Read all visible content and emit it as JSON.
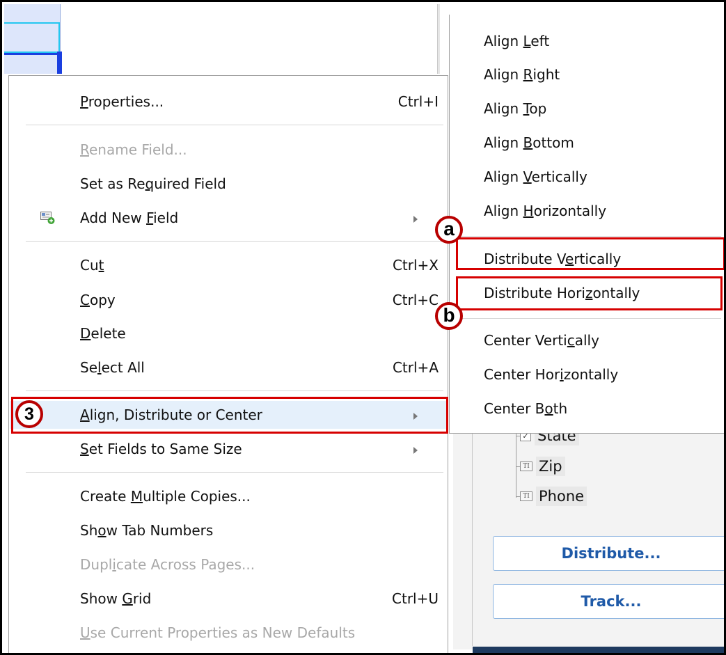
{
  "context_menu": {
    "items": [
      {
        "pre": "",
        "u": "P",
        "post": "roperties...",
        "shortcut": "Ctrl+I",
        "enabled": true
      },
      {
        "pre": "",
        "u": "R",
        "post": "ename Field...",
        "shortcut": "",
        "enabled": false
      },
      {
        "pre": "Set as Re",
        "u": "q",
        "post": "uired Field",
        "shortcut": "",
        "enabled": true
      },
      {
        "pre": "Add New ",
        "u": "F",
        "post": "ield",
        "shortcut": "",
        "enabled": true,
        "submenu": true,
        "icon": "add-field-icon"
      },
      {
        "pre": "Cu",
        "u": "t",
        "post": "",
        "shortcut": "Ctrl+X",
        "enabled": true
      },
      {
        "pre": "",
        "u": "C",
        "post": "opy",
        "shortcut": "Ctrl+C",
        "enabled": true
      },
      {
        "pre": "",
        "u": "D",
        "post": "elete",
        "shortcut": "",
        "enabled": true
      },
      {
        "pre": "Se",
        "u": "l",
        "post": "ect All",
        "shortcut": "Ctrl+A",
        "enabled": true
      },
      {
        "pre": "",
        "u": "A",
        "post": "lign, Distribute or Center",
        "shortcut": "",
        "enabled": true,
        "submenu": true,
        "highlighted": true
      },
      {
        "pre": "",
        "u": "S",
        "post": "et Fields to Same Size",
        "shortcut": "",
        "enabled": true,
        "submenu": true
      },
      {
        "pre": "Create ",
        "u": "M",
        "post": "ultiple Copies...",
        "shortcut": "",
        "enabled": true
      },
      {
        "pre": "Sh",
        "u": "o",
        "post": "w Tab Numbers",
        "shortcut": "",
        "enabled": true
      },
      {
        "pre": "Dupl",
        "u": "i",
        "post": "cate Across Pages...",
        "shortcut": "",
        "enabled": false
      },
      {
        "pre": "Show ",
        "u": "G",
        "post": "rid",
        "shortcut": "Ctrl+U",
        "enabled": true
      },
      {
        "pre": "",
        "u": "U",
        "post": "se Current Properties as New Defaults",
        "shortcut": "",
        "enabled": false
      }
    ]
  },
  "submenu": {
    "items": [
      {
        "pre": "Align ",
        "u": "L",
        "post": "eft"
      },
      {
        "pre": "Align ",
        "u": "R",
        "post": "ight"
      },
      {
        "pre": "Align ",
        "u": "T",
        "post": "op"
      },
      {
        "pre": "Align ",
        "u": "B",
        "post": "ottom"
      },
      {
        "pre": "Align ",
        "u": "V",
        "post": "ertically"
      },
      {
        "pre": "Align ",
        "u": "H",
        "post": "orizontally"
      },
      {
        "pre": "Distribute V",
        "u": "e",
        "post": "rtically"
      },
      {
        "pre": "Distribute Hori",
        "u": "z",
        "post": "ontally"
      },
      {
        "pre": "Center Verti",
        "u": "c",
        "post": "ally"
      },
      {
        "pre": "Center Hor",
        "u": "i",
        "post": "zontally"
      },
      {
        "pre": "Center B",
        "u": "o",
        "post": "th"
      }
    ]
  },
  "fields_tree": {
    "items": [
      {
        "label": "State",
        "icon": "checkbox-icon"
      },
      {
        "label": "Zip",
        "icon": "text-field-icon"
      },
      {
        "label": "Phone",
        "icon": "text-field-icon"
      }
    ],
    "text_field_glyph": "TI",
    "checkbox_glyph": "✓"
  },
  "panel_buttons": {
    "distribute": "Distribute...",
    "track": "Track..."
  },
  "annotations": {
    "step3": "3",
    "a": "a",
    "b": "b"
  },
  "colors": {
    "annotation_red": "#d60000",
    "highlight": "#e5f0fb",
    "selection_blue": "#1a3fe0"
  }
}
